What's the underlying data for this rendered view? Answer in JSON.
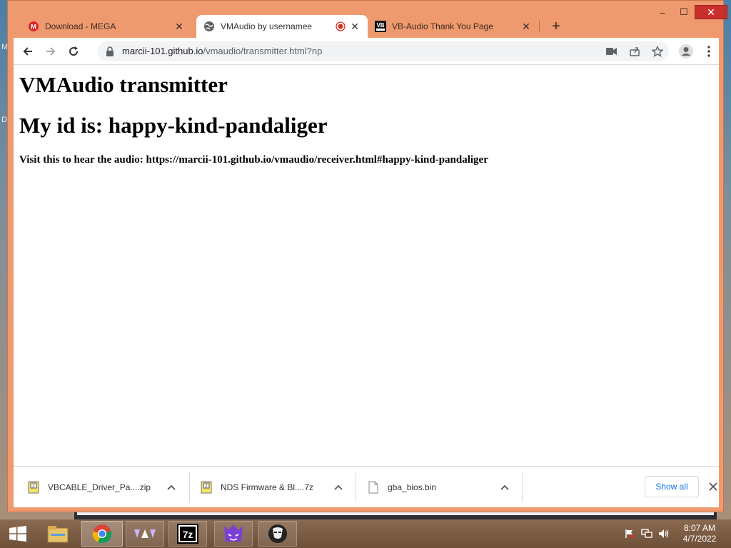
{
  "desktop": {
    "edge_letters": [
      "M",
      "D"
    ]
  },
  "tabs": [
    {
      "title": "Download - MEGA",
      "icon": "mega-icon",
      "active": false
    },
    {
      "title": "VMAudio by usernamee",
      "icon": "globe-icon",
      "active": true,
      "recording": true
    },
    {
      "title": "VB-Audio Thank You Page",
      "icon": "vb-audio-icon",
      "active": false
    }
  ],
  "window_controls": {
    "minimize": "–",
    "maximize": "☐",
    "close": "✕"
  },
  "toolbar": {
    "url_host": "marcii-101.github.io",
    "url_path": "/vmaudio/transmitter.html?np"
  },
  "page": {
    "heading1": "VMAudio transmitter",
    "heading2": "My id is: happy-kind-pandaliger",
    "visit_text": "Visit this to hear the audio: https://marcii-101.github.io/vmaudio/receiver.html#happy-kind-pandaliger"
  },
  "downloads": {
    "items": [
      {
        "name": "VBCABLE_Driver_Pa....zip",
        "icon": "zip-file-icon"
      },
      {
        "name": "NDS Firmware & Bl....7z",
        "icon": "zip-file-icon"
      },
      {
        "name": "gba_bios.bin",
        "icon": "file-icon"
      }
    ],
    "show_all_label": "Show all"
  },
  "taskbar": {
    "time": "8:07 AM",
    "date": "4/7/2022",
    "apps": [
      "start-button",
      "file-explorer",
      "chrome",
      "app-triangles",
      "7zip",
      "app-purple-cat",
      "app-masked-figure"
    ]
  },
  "colors": {
    "frame": "#ef9a6e",
    "taskbar": "#6e4f38",
    "link_blue": "#1a73e8",
    "record_red": "#d93025"
  }
}
